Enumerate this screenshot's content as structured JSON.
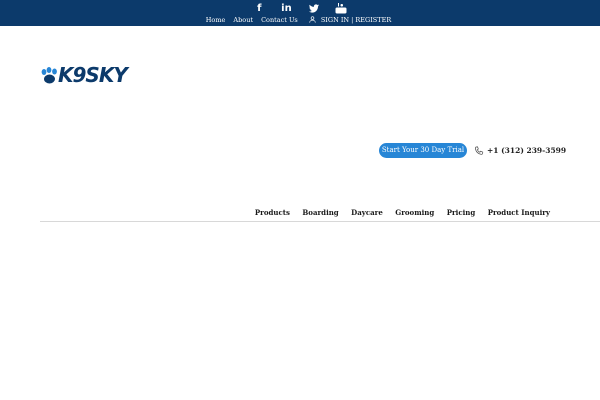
{
  "topbar": {
    "social": [
      {
        "name": "facebook-icon",
        "glyph": "f"
      },
      {
        "name": "linkedin-icon",
        "glyph": "in"
      },
      {
        "name": "twitter-icon",
        "glyph": ""
      },
      {
        "name": "youtube-icon",
        "glyph": ""
      }
    ],
    "links": {
      "home": "Home",
      "about": "About",
      "contact": "Contact Us",
      "signin": "SIGN IN | REGISTER"
    },
    "bg_color": "#0c3a6b"
  },
  "logo": {
    "wordmark": "K9SKY",
    "color": "#0c3a6b"
  },
  "cta": {
    "trial_label": "Start Your 30 Day Trial",
    "phone": "+1 (312) 239-3599",
    "accent_color": "#2786d6"
  },
  "nav": {
    "items": [
      "Products",
      "Boarding",
      "Daycare",
      "Grooming",
      "Pricing",
      "Product Inquiry"
    ]
  }
}
